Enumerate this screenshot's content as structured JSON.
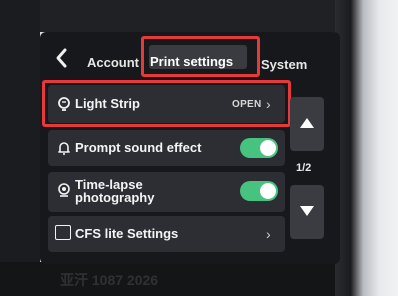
{
  "header": {
    "back_icon": "chevron-left-icon",
    "tabs": [
      {
        "label": "Account"
      },
      {
        "label": "Print settings",
        "selected": true
      },
      {
        "label": "System"
      }
    ]
  },
  "rows": [
    {
      "label": "Light Strip",
      "icon": "lightbulb-icon",
      "value": "OPEN",
      "type": "link"
    },
    {
      "label": "Prompt sound effect",
      "icon": "bell-icon",
      "type": "toggle",
      "on": true
    },
    {
      "label_line1": "Time-lapse",
      "label_line2": "photography",
      "icon": "camera-icon",
      "type": "toggle",
      "on": true
    },
    {
      "label": "CFS lite Settings",
      "icon": "cfs-icon",
      "icon_text": "CFS lite",
      "type": "link"
    }
  ],
  "pager": {
    "indicator": "1/2"
  },
  "watermark": "亚汗 1087 2026",
  "colors": {
    "highlight": "#e43a3c",
    "toggle_on": "#46c47f",
    "screen_bg": "#17181b",
    "row_bg": "#2c2e33"
  }
}
